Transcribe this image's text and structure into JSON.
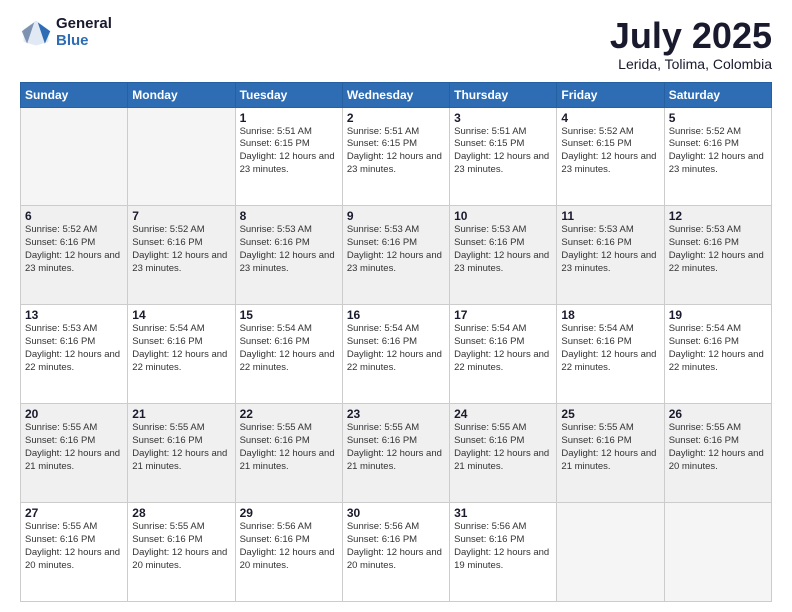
{
  "logo": {
    "general": "General",
    "blue": "Blue"
  },
  "header": {
    "month": "July 2025",
    "location": "Lerida, Tolima, Colombia"
  },
  "weekdays": [
    "Sunday",
    "Monday",
    "Tuesday",
    "Wednesday",
    "Thursday",
    "Friday",
    "Saturday"
  ],
  "weeks": [
    [
      {
        "day": "",
        "empty": true
      },
      {
        "day": "",
        "empty": true
      },
      {
        "day": "1",
        "sunrise": "Sunrise: 5:51 AM",
        "sunset": "Sunset: 6:15 PM",
        "daylight": "Daylight: 12 hours and 23 minutes."
      },
      {
        "day": "2",
        "sunrise": "Sunrise: 5:51 AM",
        "sunset": "Sunset: 6:15 PM",
        "daylight": "Daylight: 12 hours and 23 minutes."
      },
      {
        "day": "3",
        "sunrise": "Sunrise: 5:51 AM",
        "sunset": "Sunset: 6:15 PM",
        "daylight": "Daylight: 12 hours and 23 minutes."
      },
      {
        "day": "4",
        "sunrise": "Sunrise: 5:52 AM",
        "sunset": "Sunset: 6:15 PM",
        "daylight": "Daylight: 12 hours and 23 minutes."
      },
      {
        "day": "5",
        "sunrise": "Sunrise: 5:52 AM",
        "sunset": "Sunset: 6:16 PM",
        "daylight": "Daylight: 12 hours and 23 minutes."
      }
    ],
    [
      {
        "day": "6",
        "sunrise": "Sunrise: 5:52 AM",
        "sunset": "Sunset: 6:16 PM",
        "daylight": "Daylight: 12 hours and 23 minutes."
      },
      {
        "day": "7",
        "sunrise": "Sunrise: 5:52 AM",
        "sunset": "Sunset: 6:16 PM",
        "daylight": "Daylight: 12 hours and 23 minutes."
      },
      {
        "day": "8",
        "sunrise": "Sunrise: 5:53 AM",
        "sunset": "Sunset: 6:16 PM",
        "daylight": "Daylight: 12 hours and 23 minutes."
      },
      {
        "day": "9",
        "sunrise": "Sunrise: 5:53 AM",
        "sunset": "Sunset: 6:16 PM",
        "daylight": "Daylight: 12 hours and 23 minutes."
      },
      {
        "day": "10",
        "sunrise": "Sunrise: 5:53 AM",
        "sunset": "Sunset: 6:16 PM",
        "daylight": "Daylight: 12 hours and 23 minutes."
      },
      {
        "day": "11",
        "sunrise": "Sunrise: 5:53 AM",
        "sunset": "Sunset: 6:16 PM",
        "daylight": "Daylight: 12 hours and 23 minutes."
      },
      {
        "day": "12",
        "sunrise": "Sunrise: 5:53 AM",
        "sunset": "Sunset: 6:16 PM",
        "daylight": "Daylight: 12 hours and 22 minutes."
      }
    ],
    [
      {
        "day": "13",
        "sunrise": "Sunrise: 5:53 AM",
        "sunset": "Sunset: 6:16 PM",
        "daylight": "Daylight: 12 hours and 22 minutes."
      },
      {
        "day": "14",
        "sunrise": "Sunrise: 5:54 AM",
        "sunset": "Sunset: 6:16 PM",
        "daylight": "Daylight: 12 hours and 22 minutes."
      },
      {
        "day": "15",
        "sunrise": "Sunrise: 5:54 AM",
        "sunset": "Sunset: 6:16 PM",
        "daylight": "Daylight: 12 hours and 22 minutes."
      },
      {
        "day": "16",
        "sunrise": "Sunrise: 5:54 AM",
        "sunset": "Sunset: 6:16 PM",
        "daylight": "Daylight: 12 hours and 22 minutes."
      },
      {
        "day": "17",
        "sunrise": "Sunrise: 5:54 AM",
        "sunset": "Sunset: 6:16 PM",
        "daylight": "Daylight: 12 hours and 22 minutes."
      },
      {
        "day": "18",
        "sunrise": "Sunrise: 5:54 AM",
        "sunset": "Sunset: 6:16 PM",
        "daylight": "Daylight: 12 hours and 22 minutes."
      },
      {
        "day": "19",
        "sunrise": "Sunrise: 5:54 AM",
        "sunset": "Sunset: 6:16 PM",
        "daylight": "Daylight: 12 hours and 22 minutes."
      }
    ],
    [
      {
        "day": "20",
        "sunrise": "Sunrise: 5:55 AM",
        "sunset": "Sunset: 6:16 PM",
        "daylight": "Daylight: 12 hours and 21 minutes."
      },
      {
        "day": "21",
        "sunrise": "Sunrise: 5:55 AM",
        "sunset": "Sunset: 6:16 PM",
        "daylight": "Daylight: 12 hours and 21 minutes."
      },
      {
        "day": "22",
        "sunrise": "Sunrise: 5:55 AM",
        "sunset": "Sunset: 6:16 PM",
        "daylight": "Daylight: 12 hours and 21 minutes."
      },
      {
        "day": "23",
        "sunrise": "Sunrise: 5:55 AM",
        "sunset": "Sunset: 6:16 PM",
        "daylight": "Daylight: 12 hours and 21 minutes."
      },
      {
        "day": "24",
        "sunrise": "Sunrise: 5:55 AM",
        "sunset": "Sunset: 6:16 PM",
        "daylight": "Daylight: 12 hours and 21 minutes."
      },
      {
        "day": "25",
        "sunrise": "Sunrise: 5:55 AM",
        "sunset": "Sunset: 6:16 PM",
        "daylight": "Daylight: 12 hours and 21 minutes."
      },
      {
        "day": "26",
        "sunrise": "Sunrise: 5:55 AM",
        "sunset": "Sunset: 6:16 PM",
        "daylight": "Daylight: 12 hours and 20 minutes."
      }
    ],
    [
      {
        "day": "27",
        "sunrise": "Sunrise: 5:55 AM",
        "sunset": "Sunset: 6:16 PM",
        "daylight": "Daylight: 12 hours and 20 minutes."
      },
      {
        "day": "28",
        "sunrise": "Sunrise: 5:55 AM",
        "sunset": "Sunset: 6:16 PM",
        "daylight": "Daylight: 12 hours and 20 minutes."
      },
      {
        "day": "29",
        "sunrise": "Sunrise: 5:56 AM",
        "sunset": "Sunset: 6:16 PM",
        "daylight": "Daylight: 12 hours and 20 minutes."
      },
      {
        "day": "30",
        "sunrise": "Sunrise: 5:56 AM",
        "sunset": "Sunset: 6:16 PM",
        "daylight": "Daylight: 12 hours and 20 minutes."
      },
      {
        "day": "31",
        "sunrise": "Sunrise: 5:56 AM",
        "sunset": "Sunset: 6:16 PM",
        "daylight": "Daylight: 12 hours and 19 minutes."
      },
      {
        "day": "",
        "empty": true
      },
      {
        "day": "",
        "empty": true
      }
    ]
  ]
}
